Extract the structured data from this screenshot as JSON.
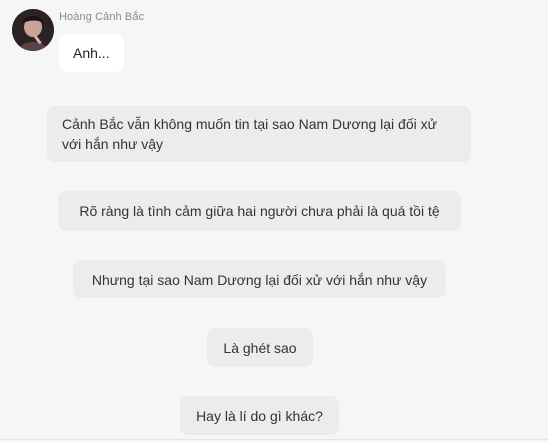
{
  "sender": {
    "name": "Hoàng Cảnh Bắc",
    "avatar_icon": "profile-photo"
  },
  "messages": {
    "first": "Anh..."
  },
  "narration": [
    "Cảnh Bắc vẫn không muốn tin tại sao Nam Dương lại đối xử với hắn như vậy",
    "Rõ ràng là tình cảm giữa hai người chưa phải là quá tồi tệ",
    "Nhưng tại sao Nam Dương lại đối xử với hắn như vậy",
    "Là ghét sao",
    "Hay là lí do gì khác?"
  ],
  "colors": {
    "background": "#f6f6f6",
    "narration_bubble": "#ececec",
    "message_bubble": "#ffffff",
    "sender_name": "#8a8a8a"
  }
}
